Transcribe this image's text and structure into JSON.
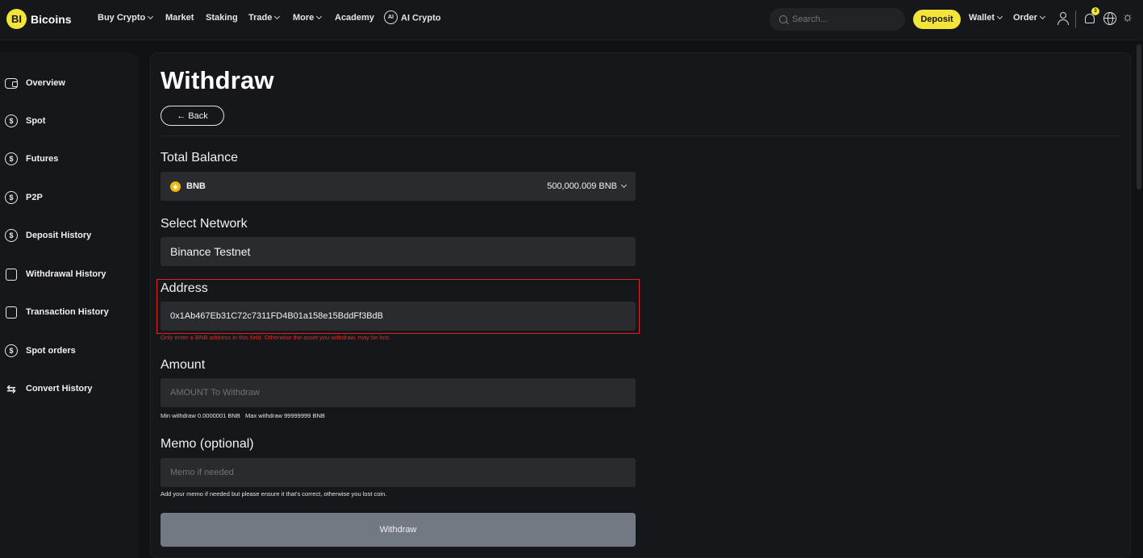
{
  "brand": {
    "logo_mark": "BI",
    "name": "Bicoins"
  },
  "nav": {
    "buy_crypto": "Buy Crypto",
    "market": "Market",
    "staking": "Staking",
    "trade": "Trade",
    "more": "More",
    "academy": "Academy",
    "ai_crypto": "AI Crypto",
    "ai_icon_text": "AI"
  },
  "header": {
    "search_placeholder": "Search...",
    "deposit": "Deposit",
    "wallet": "Wallet",
    "order": "Order",
    "notification_count": "3"
  },
  "sidebar": {
    "items": [
      {
        "label": "Overview",
        "icon": "wallet-icon"
      },
      {
        "label": "Spot",
        "icon": "dollar-circle-icon"
      },
      {
        "label": "Futures",
        "icon": "coin-up-icon"
      },
      {
        "label": "P2P",
        "icon": "coin-up-icon"
      },
      {
        "label": "Deposit History",
        "icon": "coin-up-icon"
      },
      {
        "label": "Withdrawal History",
        "icon": "document-icon"
      },
      {
        "label": "Transaction History",
        "icon": "receipt-icon"
      },
      {
        "label": "Spot orders",
        "icon": "coins-icon"
      },
      {
        "label": "Convert History",
        "icon": "swap-icon"
      }
    ]
  },
  "main": {
    "title": "Withdraw",
    "back_label": "← Back",
    "total_balance_label": "Total Balance",
    "coin": "BNB",
    "balance": "500,000.009 BNB",
    "network_label": "Select Network",
    "network_value": "Binance Testnet",
    "address_label": "Address",
    "address_value": "0x1Ab467Eb31C72c7311FD4B01a158e15BddFf3BdB",
    "address_warning": "Only enter a BNB address in this field. Otherwise the asset you withdraw, may be lost.",
    "amount_label": "Amount",
    "amount_placeholder": "AMOUNT To Withdraw",
    "amount_limits": "Min withdraw 0.0000001 BNB   Max withdraw 99999999 BNB",
    "memo_label": "Memo (optional)",
    "memo_placeholder": "Memo if needed",
    "memo_hint": "Add your memo if needed but please ensure it that's correct, otherwise you lost coin.",
    "withdraw_button": "Withdraw"
  },
  "colors": {
    "accent": "#f3e43a",
    "background": "#111214",
    "panel": "#16171a",
    "field": "#2a2b2f",
    "warning": "#d32f2f",
    "highlight_box": "#e0221c",
    "button_disabled": "#737983"
  }
}
